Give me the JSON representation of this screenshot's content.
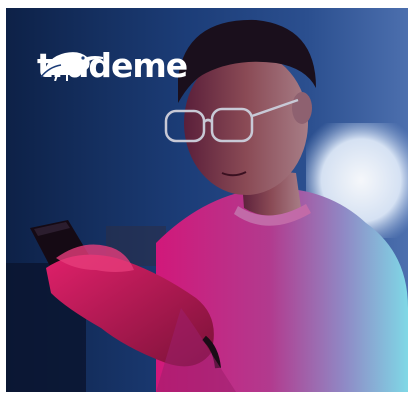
{
  "brand": {
    "name": "trademe",
    "logo_icon": "kiwi-bird-icon",
    "logo_color": "#ffffff"
  },
  "photo": {
    "subject": "person-looking-at-phone",
    "colors": {
      "background": "#17305f",
      "magenta_light": "#d1187a",
      "cyan_light": "#7fd8e6"
    }
  }
}
